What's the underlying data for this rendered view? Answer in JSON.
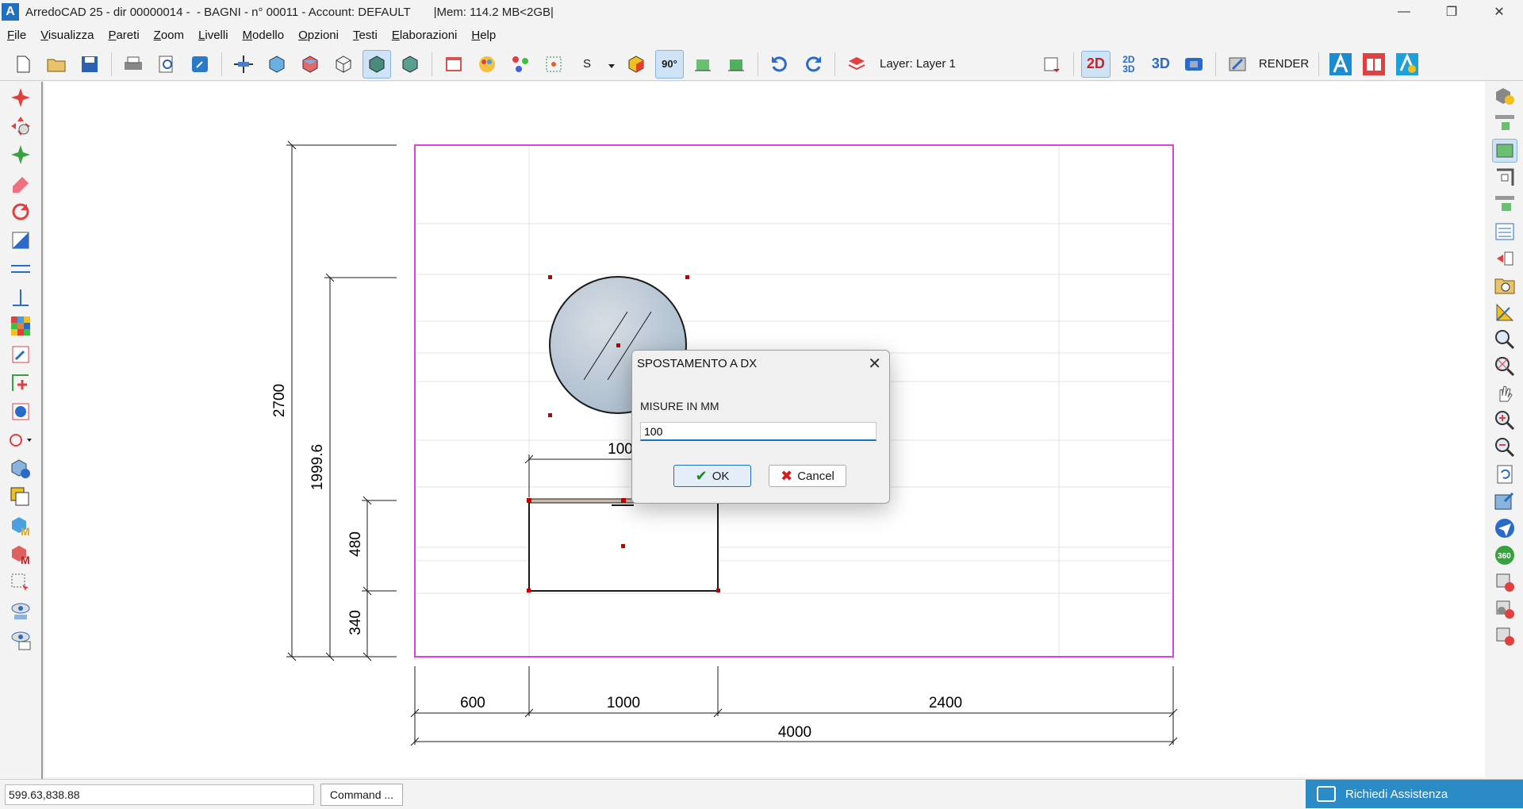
{
  "window": {
    "logo_letter": "A",
    "title": "ArredoCAD 25 - dir 00000014 -  - BAGNI - n° 00011 - Account: DEFAULT       |Mem: 114.2 MB<2GB|",
    "minimize": "—",
    "restore": "❐",
    "close": "✕"
  },
  "menu": [
    "File",
    "Visualizza",
    "Pareti",
    "Zoom",
    "Livelli",
    "Modello",
    "Opzioni",
    "Testi",
    "Elaborazioni",
    "Help"
  ],
  "toolbar": {
    "s_label": "S",
    "angle_label": "90°",
    "layer_label": "Layer:  Layer 1",
    "mode_2d": "2D",
    "mode_2d3d": "2D 3D",
    "mode_3d": "3D",
    "render_label": "RENDER"
  },
  "drawing": {
    "dims": {
      "height_total": "2700",
      "height_inner": "1999.6",
      "h480": "480",
      "h340": "340",
      "w600": "600",
      "w1000": "1000",
      "w2400": "2400",
      "w4000": "4000",
      "top_label": "100"
    },
    "colors": {
      "wall_outline": "#e040e0",
      "selection_marker": "#c00000",
      "line": "#1a1a1a"
    }
  },
  "dialog": {
    "title": "SPOSTAMENTO A DX",
    "close": "✕",
    "label": "MISURE IN MM",
    "value": "100",
    "ok": "OK",
    "cancel": "Cancel"
  },
  "status": {
    "coords": "599.63,838.88",
    "command_button": "Command ...",
    "help_button": "Richiedi Assistenza"
  }
}
